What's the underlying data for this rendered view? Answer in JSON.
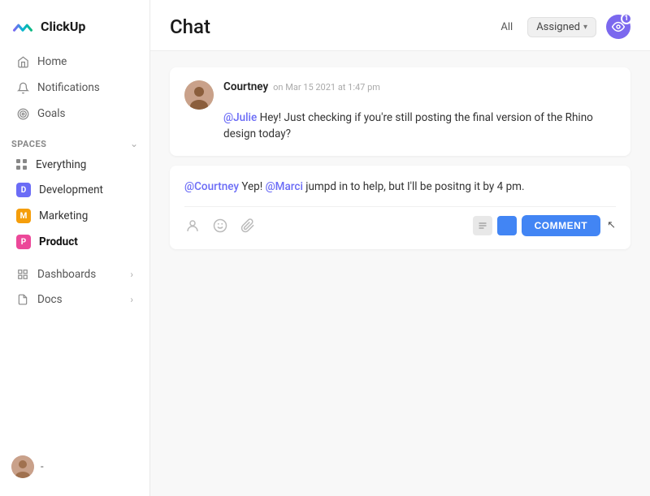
{
  "logo": {
    "text": "ClickUp"
  },
  "sidebar": {
    "nav": [
      {
        "id": "home",
        "label": "Home",
        "icon": "home"
      },
      {
        "id": "notifications",
        "label": "Notifications",
        "icon": "bell"
      },
      {
        "id": "goals",
        "label": "Goals",
        "icon": "target"
      }
    ],
    "spaces_label": "Spaces",
    "spaces": [
      {
        "id": "everything",
        "label": "Everything",
        "type": "grid"
      },
      {
        "id": "development",
        "label": "Development",
        "type": "badge",
        "letter": "D",
        "color": "#6B6CF6"
      },
      {
        "id": "marketing",
        "label": "Marketing",
        "type": "badge",
        "letter": "M",
        "color": "#F59E0B"
      },
      {
        "id": "product",
        "label": "Product",
        "type": "badge",
        "letter": "P",
        "color": "#EC4899",
        "bold": true
      }
    ],
    "sections": [
      {
        "id": "dashboards",
        "label": "Dashboards"
      },
      {
        "id": "docs",
        "label": "Docs"
      }
    ],
    "user": {
      "name": "-"
    }
  },
  "header": {
    "title": "Chat",
    "tab_all": "All",
    "tab_assigned": "Assigned",
    "notification_count": "1"
  },
  "messages": [
    {
      "id": "msg1",
      "author": "Courtney",
      "timestamp": "on Mar 15 2021 at 1:47 pm",
      "body_prefix": "@Julie",
      "body_text": " Hey! Just checking if you're still posting the final version of the Rhino design today?"
    }
  ],
  "reply": {
    "body_mention1": "@Courtney",
    "body_text1": " Yep! ",
    "body_mention2": "@Marci",
    "body_text2": " jumpd in to help, but I'll be positng it by 4 pm."
  },
  "toolbar": {
    "comment_label": "COMMENT"
  }
}
